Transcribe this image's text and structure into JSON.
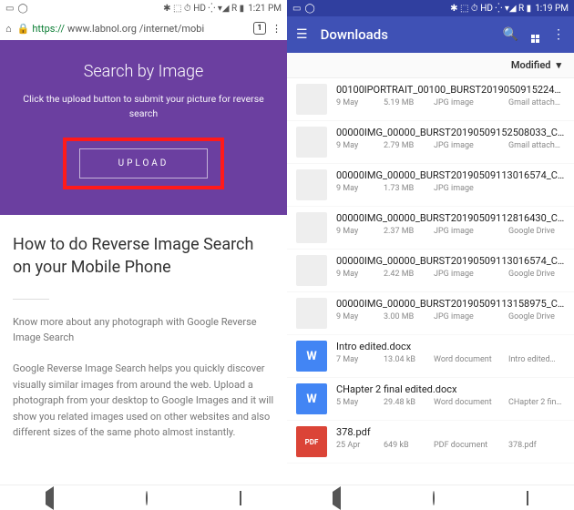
{
  "left": {
    "status": {
      "time": "1:21 PM",
      "indicators": "✱ ⬚ ⏱ HD ⁛ ▾◢ R ▮"
    },
    "chrome": {
      "url_secure": "https://",
      "url_host": "www.labnol.org",
      "url_path": "/internet/mobi",
      "tab_count": "1"
    },
    "hero": {
      "title": "Search by Image",
      "subtitle": "Click the upload button to submit your picture for reverse search",
      "upload_label": "UPLOAD"
    },
    "article": {
      "heading": "How to do Reverse Image Search on your Mobile Phone",
      "p1": "Know more about any photograph with Google Reverse Image Search",
      "p2": "Google Reverse Image Search helps you quickly discover visually similar images from around the web. Upload a photograph from your desktop to Google Images and it will show you related images used on other websites and also different sizes of the same photo almost instantly."
    }
  },
  "right": {
    "status": {
      "time": "1:19 PM",
      "indicators": "✱ ⬚ ⏱ HD ⁛ ▾◢ R ▮"
    },
    "appbar": {
      "title": "Downloads"
    },
    "sort": {
      "label": "Modified"
    },
    "files": [
      {
        "name": "00100lPORTRAIT_00100_BURST20190509152241…",
        "date": "9 May",
        "size": "5.19 MB",
        "type": "JPG image",
        "src": "Gmail attach…",
        "thumb": "img"
      },
      {
        "name": "00000IMG_00000_BURST20190509152508033_C…",
        "date": "9 May",
        "size": "2.79 MB",
        "type": "JPG image",
        "src": "Gmail attach…",
        "thumb": "img"
      },
      {
        "name": "00000IMG_00000_BURST20190509113016574_C…",
        "date": "9 May",
        "size": "1.73 MB",
        "type": "JPG image",
        "src": "",
        "thumb": "img"
      },
      {
        "name": "00000IMG_00000_BURST20190509112816430_C…",
        "date": "9 May",
        "size": "2.37 MB",
        "type": "JPG image",
        "src": "Google Drive",
        "thumb": "img"
      },
      {
        "name": "00000IMG_00000_BURST20190509113016574_C…",
        "date": "9 May",
        "size": "2.42 MB",
        "type": "JPG image",
        "src": "Google Drive",
        "thumb": "img"
      },
      {
        "name": "00000IMG_00000_BURST20190509113158975_C…",
        "date": "9 May",
        "size": "3.00 MB",
        "type": "JPG image",
        "src": "Google Drive",
        "thumb": "img"
      },
      {
        "name": "Intro edited.docx",
        "date": "7 May",
        "size": "13.04 kB",
        "type": "Word document",
        "src": "Intro edited…",
        "thumb": "doc"
      },
      {
        "name": "CHapter 2 final edited.docx",
        "date": "5 May",
        "size": "29.48 kB",
        "type": "Word document",
        "src": "CHapter 2 fin…",
        "thumb": "doc"
      },
      {
        "name": "378.pdf",
        "date": "25 Apr",
        "size": "649 kB",
        "type": "PDF document",
        "src": "378.pdf",
        "thumb": "pdf"
      }
    ]
  }
}
